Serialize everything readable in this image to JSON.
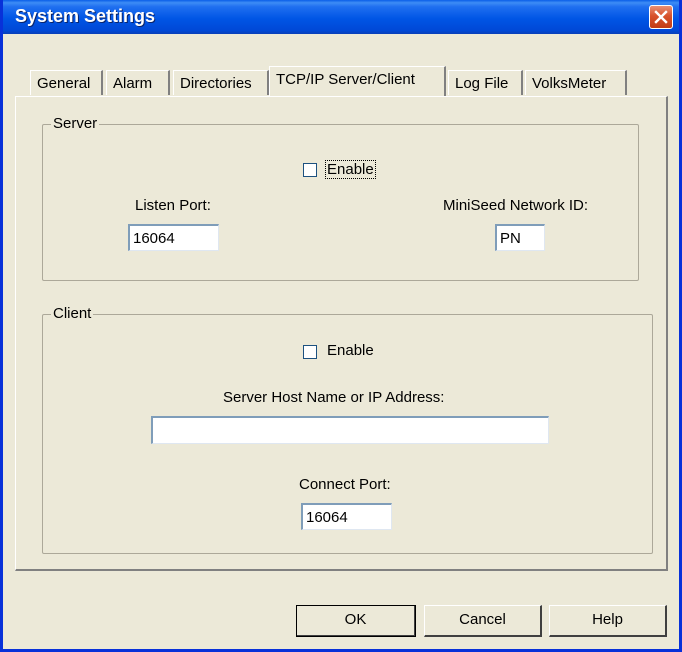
{
  "window": {
    "title": "System Settings"
  },
  "tabs": [
    {
      "label": "General"
    },
    {
      "label": "Alarm"
    },
    {
      "label": "Directories"
    },
    {
      "label": "TCP/IP Server/Client",
      "active": true
    },
    {
      "label": "Log File"
    },
    {
      "label": "VolksMeter"
    }
  ],
  "server": {
    "group_label": "Server",
    "enable_label": "Enable",
    "enable_checked": false,
    "listen_port_label": "Listen Port:",
    "listen_port_value": "16064",
    "network_id_label": "MiniSeed Network ID:",
    "network_id_value": "PN"
  },
  "client": {
    "group_label": "Client",
    "enable_label": "Enable",
    "enable_checked": false,
    "host_label": "Server Host Name or IP Address:",
    "host_value": "",
    "connect_port_label": "Connect Port:",
    "connect_port_value": "16064"
  },
  "buttons": {
    "ok": "OK",
    "cancel": "Cancel",
    "help": "Help"
  },
  "colors": {
    "titlebar": "#0055e5",
    "dialog_bg": "#ece9d8",
    "close_button": "#d8522c"
  },
  "icons": {
    "close": "close-icon"
  }
}
